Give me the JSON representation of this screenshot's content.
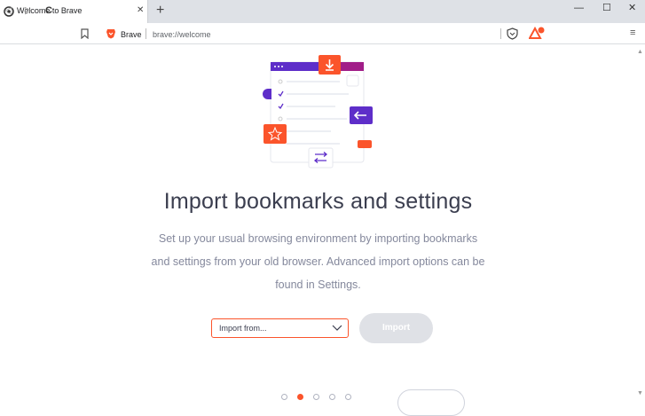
{
  "browser": {
    "tab": {
      "title": "Welcome to Brave",
      "close_glyph": "✕",
      "favicon": "brave-settings-icon"
    },
    "new_tab_glyph": "+",
    "window_controls": {
      "minimize": "—",
      "maximize": "☐",
      "close": "✕"
    },
    "toolbar": {
      "back_glyph": "◁",
      "forward_glyph": "▷",
      "reload_glyph": "C",
      "bookmark_icon": "bookmark-icon",
      "site_label": "Brave",
      "url": "brave://welcome",
      "menu_glyph": "≡"
    },
    "colors": {
      "brave_orange": "#fb542b",
      "purple": "#5e2ec9",
      "text_dark": "#3b3e4f",
      "text_muted": "#84889c"
    }
  },
  "welcome": {
    "heading": "Import bookmarks and settings",
    "description": "Set up your usual browsing environment by importing bookmarks and settings from your old browser. Advanced import options can be found in Settings.",
    "import_select": {
      "selected": "Import from..."
    },
    "import_button": "Import",
    "pagination": {
      "total": 5,
      "current": 2
    }
  }
}
